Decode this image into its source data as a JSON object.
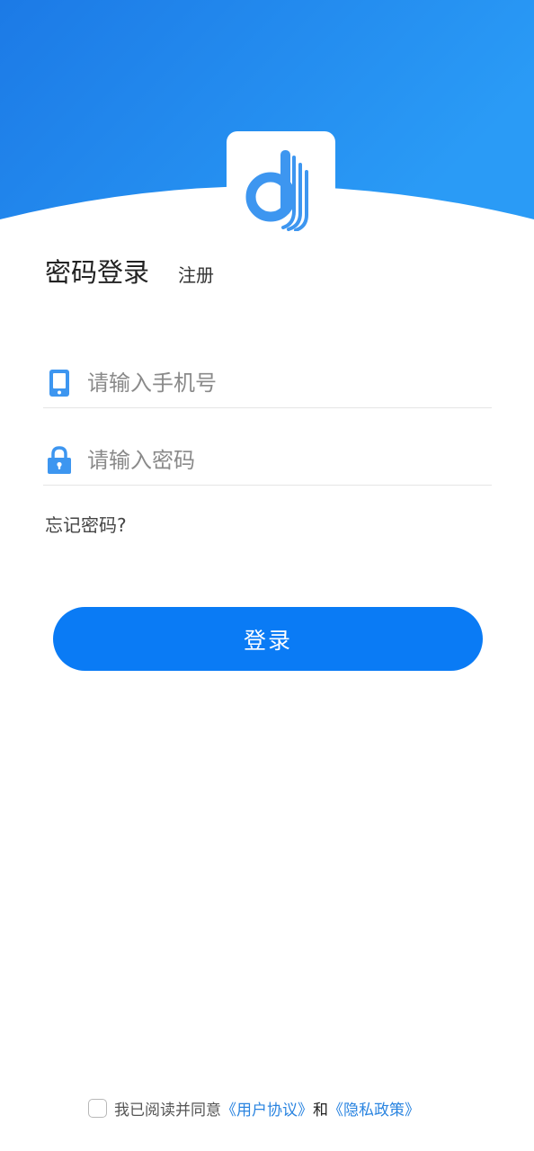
{
  "brand": {
    "gradient_start": "#1c7ae6",
    "gradient_end": "#2a9bf6",
    "logo_color": "#3d96f0"
  },
  "tabs": {
    "password_login": "密码登录",
    "register": "注册"
  },
  "form": {
    "phone_placeholder": "请输入手机号",
    "password_placeholder": "请输入密码",
    "phone_icon": "phone-icon",
    "lock_icon": "lock-icon",
    "forgot_password": "忘记密码?"
  },
  "login_button": {
    "label": "登录",
    "color": "#0a7bf5"
  },
  "agreement": {
    "prefix": "我已阅读并同意",
    "user_agreement": "《用户协议》",
    "and": "和",
    "privacy_policy": "《隐私政策》",
    "checked": false
  }
}
